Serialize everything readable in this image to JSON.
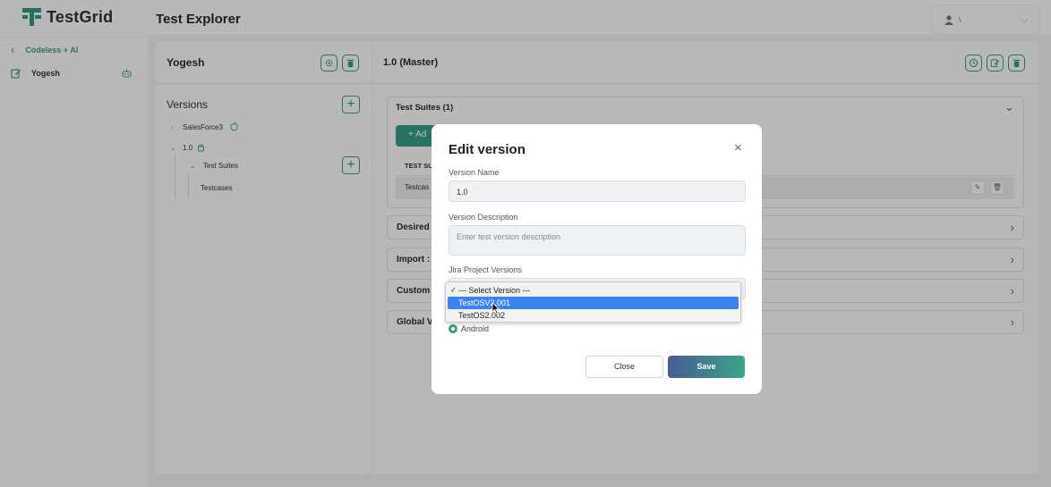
{
  "app": {
    "name": "TestGrid",
    "brand_color": "#2e9c86",
    "accent_color": "#3a9e88"
  },
  "sidebar": {
    "back_label": "Codeless + AI",
    "project_name": "Yogesh"
  },
  "header": {
    "title": "Test Explorer",
    "user_initial": "\\"
  },
  "left_panel": {
    "title": "Yogesh",
    "versions_heading": "Versions",
    "tree": {
      "item1": "SalesForce3",
      "item2": "1.0",
      "child": "Test Suites",
      "grandchild": "Testcases"
    }
  },
  "right_panel": {
    "title": "1.0 (Master)",
    "test_suites_heading": "Test Suites (1)",
    "add_button": "+ Ad",
    "table_header": "TEST SU",
    "table_row": "Testcas",
    "accordions": [
      "Desired",
      "Import :",
      "Custom",
      "Global V"
    ]
  },
  "modal": {
    "title": "Edit version",
    "close_icon": "×",
    "version_name_label": "Version Name",
    "version_name_value": "1.0",
    "version_description_label": "Version Description",
    "version_description_placeholder": "Enter test version description",
    "jira_label": "Jira Project Versions",
    "radio_label": "Android",
    "close_button": "Close",
    "save_button": "Save"
  },
  "dropdown": {
    "options": [
      "--- Select Version ---",
      "TestOSV2.001",
      "TestOS2.002"
    ],
    "checked_index": 0,
    "highlighted_index": 1,
    "highlight_color": "#3b82f6"
  }
}
